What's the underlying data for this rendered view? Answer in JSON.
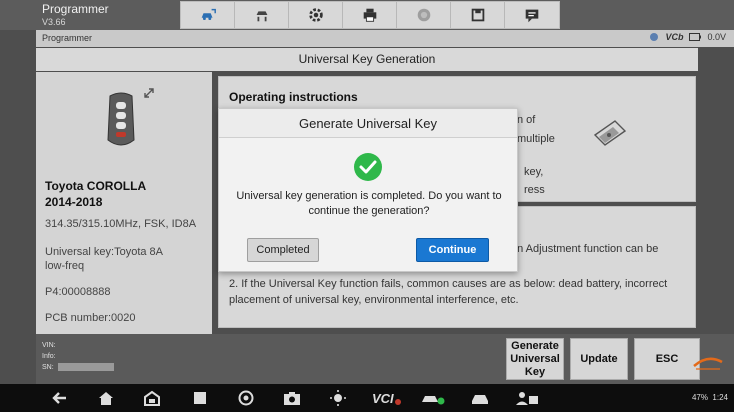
{
  "app": {
    "title": "Programmer",
    "version": "V3.66"
  },
  "toolbar": {
    "icons": [
      "car-diagnose-icon",
      "vehicle-lift-icon",
      "gear-icon",
      "printer-icon",
      "record-icon",
      "save-icon",
      "message-icon"
    ]
  },
  "status_strip": {
    "label": "Programmer",
    "vcb": "VCb",
    "voltage": "0.0V"
  },
  "section": {
    "title": "Universal Key Generation"
  },
  "vehicle": {
    "name": "Toyota COROLLA",
    "years": "2014-2018",
    "frequency": "314.35/315.10MHz, FSK, ID8A",
    "universal_key_line1": "Universal key:Toyota 8A",
    "universal_key_line2": "low-freq",
    "p4": "P4:00008888",
    "pcb": "PCB number:0020"
  },
  "operating": {
    "title": "Operating instructions",
    "frag1": "n of",
    "frag2": "multiple",
    "frag3": "key,",
    "frag4": "ress"
  },
  "notes": {
    "frag1": "on Adjustment function can be",
    "line2a": "2. If the Universal Key function fails, common causes are as below: dead battery, incorrect",
    "line2b": "placement of universal key, environmental interference, etc."
  },
  "vin_info": {
    "vin": "VIN:",
    "info": "Info:",
    "sn": "SN:"
  },
  "bottom_buttons": {
    "generate_line1": "Generate",
    "generate_line2": "Universal",
    "generate_line3": "Key",
    "update": "Update",
    "esc": "ESC"
  },
  "dialog": {
    "title": "Generate Universal Key",
    "message_line1": "Universal key generation is completed. Do you want to",
    "message_line2": "continue the generation?",
    "completed_label": "Completed",
    "continue_label": "Continue"
  },
  "system_status": {
    "battery": "47%",
    "time": "1:24"
  },
  "colors": {
    "accent": "#1a78d2",
    "check": "#2fb84a"
  }
}
